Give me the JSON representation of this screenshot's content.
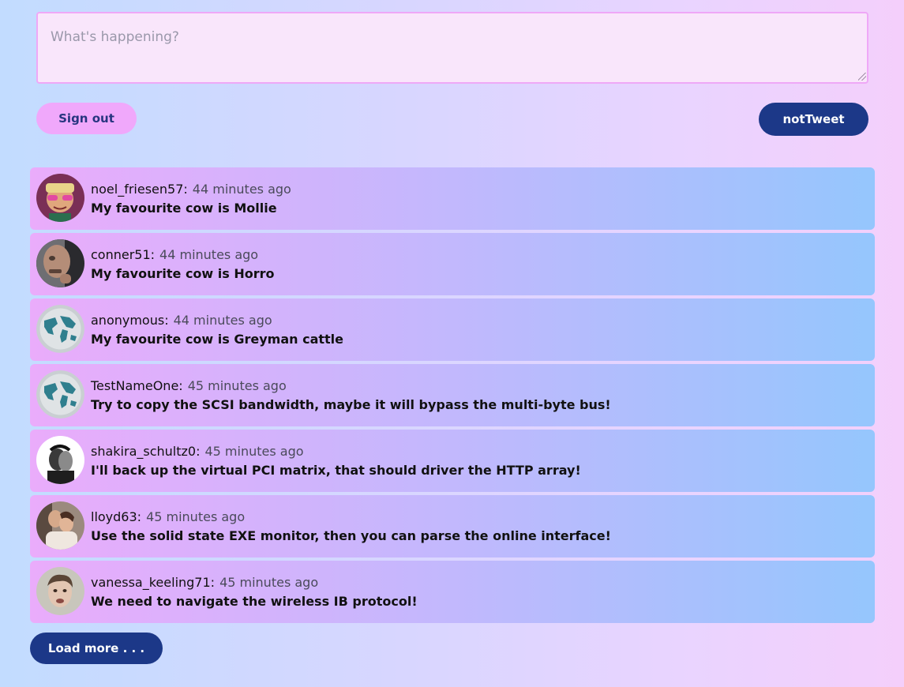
{
  "compose": {
    "placeholder": "What's happening?"
  },
  "buttons": {
    "sign_out": "Sign out",
    "tweet": "notTweet",
    "load_more": "Load more . . ."
  },
  "posts": [
    {
      "username": "noel_friesen57:",
      "time": "44 minutes ago",
      "text": "My favourite cow is Mollie",
      "avatar": "person-avatar-glasses"
    },
    {
      "username": "conner51:",
      "time": "44 minutes ago",
      "text": "My favourite cow is Horro",
      "avatar": "person-avatar-bald"
    },
    {
      "username": "anonymous:",
      "time": "44 minutes ago",
      "text": "My favourite cow is Greyman cattle",
      "avatar": "globe-avatar"
    },
    {
      "username": "TestNameOne:",
      "time": "45 minutes ago",
      "text": "Try to copy the SCSI bandwidth, maybe it will bypass the multi-byte bus!",
      "avatar": "globe-avatar"
    },
    {
      "username": "shakira_schultz0:",
      "time": "45 minutes ago",
      "text": "I'll back up the virtual PCI matrix, that should driver the HTTP array!",
      "avatar": "person-avatar-sketch"
    },
    {
      "username": "lloyd63:",
      "time": "45 minutes ago",
      "text": "Use the solid state EXE monitor, then you can parse the online interface!",
      "avatar": "person-avatar-couple"
    },
    {
      "username": "vanessa_keeling71:",
      "time": "45 minutes ago",
      "text": "We need to navigate the wireless IB protocol!",
      "avatar": "person-avatar-face"
    }
  ]
}
